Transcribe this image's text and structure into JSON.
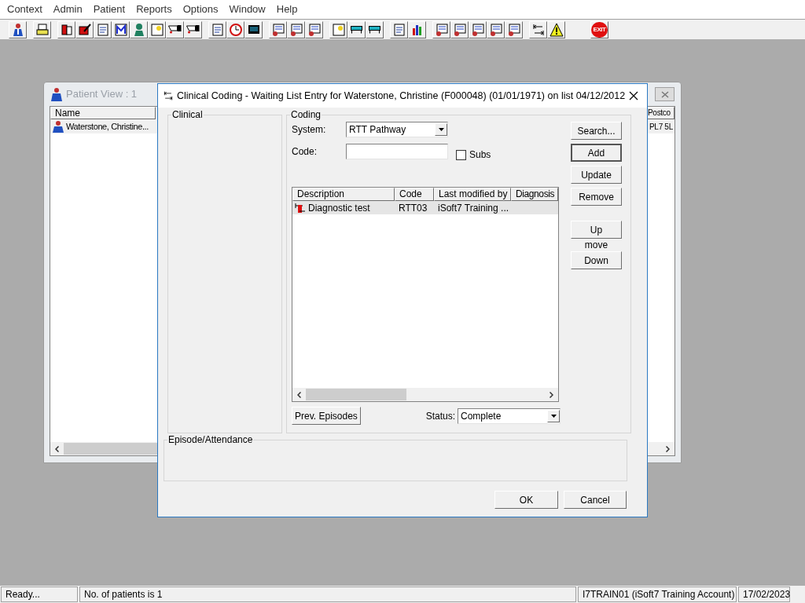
{
  "menu": [
    "Context",
    "Admin",
    "Patient",
    "Reports",
    "Options",
    "Window",
    "Help"
  ],
  "toolbar": {
    "exit_label": "EXIT"
  },
  "patient_view": {
    "title": "Patient View : 1",
    "columns": [
      "Name",
      "Postco"
    ],
    "rows": [
      {
        "name": "Waterstone, Christine...",
        "postcode": "PL7 5L",
        "selected": true
      }
    ]
  },
  "dialog": {
    "title": "Clinical Coding - Waiting List Entry for Waterstone, Christine (F000048) (01/01/1971) on list 04/12/2012",
    "clinical_label": "Clinical",
    "coding_label": "Coding",
    "system": {
      "label": "System:",
      "value": "RTT Pathway"
    },
    "code": {
      "label": "Code:"
    },
    "subs": {
      "label": "Subs",
      "checked": false
    },
    "buttons": [
      {
        "label": "Search...",
        "default": false
      },
      {
        "label": "Add",
        "default": true
      },
      {
        "label": "Update",
        "default": false
      },
      {
        "label": "Remove",
        "default": false
      }
    ],
    "move": {
      "up": "Up",
      "label": "move",
      "down": "Down"
    },
    "list": {
      "columns": [
        "Description",
        "Code",
        "Last modified by",
        "Diagnosis"
      ],
      "rows": [
        {
          "description": "Diagnostic test",
          "code": "RTT03",
          "modified_by": "iSoft7 Training ...",
          "selected": true
        }
      ]
    },
    "prev_episodes": "Prev. Episodes",
    "status": {
      "label": "Status:",
      "value": "Complete"
    },
    "episode_label": "Episode/Attendance",
    "ok": "OK",
    "cancel": "Cancel"
  },
  "status_bar": [
    "Ready...",
    "No. of patients is 1",
    "I7TRAIN01 (iSoft7 Training Account)",
    "17/02/2023"
  ]
}
